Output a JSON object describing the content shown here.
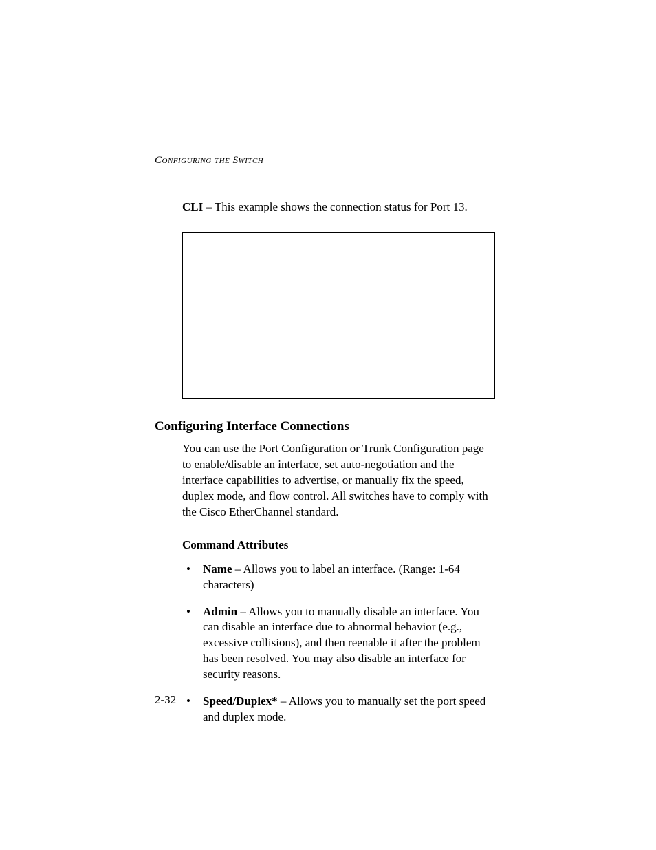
{
  "running_head": "Configuring the Switch",
  "intro": {
    "lead": "CLI",
    "rest": " – This example shows the connection status for Port 13."
  },
  "section_heading": "Configuring Interface Connections",
  "section_body": "You can use the Port Configuration or Trunk Configuration page to enable/disable an interface, set auto-negotiation and the interface capabilities to advertise, or manually fix the speed, duplex mode, and flow control. All switches have to comply with the Cisco EtherChannel standard.",
  "subheading": "Command Attributes",
  "attributes": [
    {
      "term": "Name",
      "desc": " – Allows you to label an interface. (Range: 1-64 characters)"
    },
    {
      "term": "Admin",
      "desc": " – Allows you to manually disable an interface. You can disable an interface due to abnormal behavior (e.g., excessive collisions), and then reenable it after the problem has been resolved. You may also disable an interface for security reasons."
    },
    {
      "term": "Speed/Duplex*",
      "desc": " – Allows you to manually set the port speed and duplex mode."
    }
  ],
  "page_number": "2-32"
}
